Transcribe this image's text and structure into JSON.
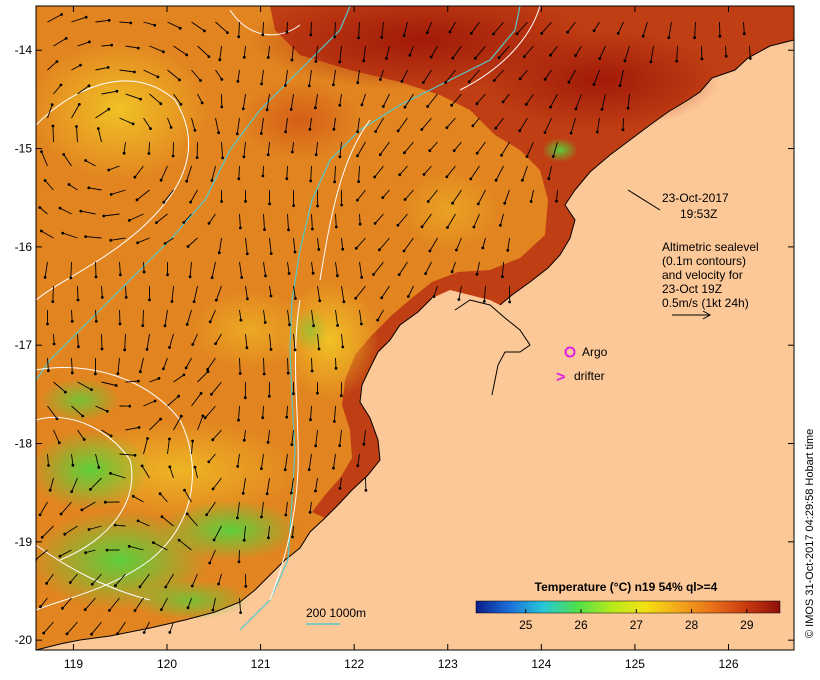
{
  "map": {
    "lon_range": [
      118.6,
      126.7
    ],
    "lat_range": [
      -20.1,
      -13.55
    ],
    "x_ticks": [
      119,
      120,
      121,
      122,
      123,
      124,
      125,
      126
    ],
    "x_tick_labels": [
      "119",
      "120",
      "121",
      "122",
      "123",
      "124",
      "125",
      "126"
    ],
    "y_ticks": [
      -14,
      -15,
      -16,
      -17,
      -18,
      -19,
      -20
    ],
    "y_tick_labels": [
      "-14",
      "-15",
      "-16",
      "-17",
      "-18",
      "-19",
      "-20"
    ]
  },
  "annotations": {
    "date": "23-Oct-2017",
    "time": "19:53Z",
    "sealevel_lines": [
      "Altimetric sealevel",
      "(0.1m contours)",
      "and velocity for",
      "23-Oct 19Z",
      "0.5m/s (1kt 24h)"
    ],
    "argo_label": "Argo",
    "drifter_label": "drifter",
    "drifter_symbol": ">",
    "isobath_label": "200  1000m"
  },
  "colorbar": {
    "title": "Temperature (°C) n19 54% ql>=4",
    "ticks": [
      "25",
      "26",
      "27",
      "28",
      "29"
    ],
    "tick_values": [
      25,
      26,
      27,
      28,
      29
    ],
    "range": [
      24.1,
      29.6
    ],
    "colors": [
      "#0a1d8a",
      "#1c6fd8",
      "#27c8d8",
      "#4fe04a",
      "#b6ea1c",
      "#f3e112",
      "#f2a81a",
      "#e9701a",
      "#c83a10",
      "#8e0f0a"
    ]
  },
  "credit": "© IMOS 31-Oct-2017 04:29:58 Hobart time",
  "colors": {
    "land": "#fdc898",
    "sea_base": "#e28420",
    "warm": "#b83010",
    "hot": "#9a1808",
    "yellow": "#f0c020",
    "green": "#6cd838",
    "isobath": "#56c8c8",
    "contour": "#ffffff",
    "argo": "#e020e0",
    "vector": "#000000"
  },
  "icons": [
    "argo-circle-icon",
    "drifter-chevron-icon",
    "scale-arrow-icon"
  ]
}
